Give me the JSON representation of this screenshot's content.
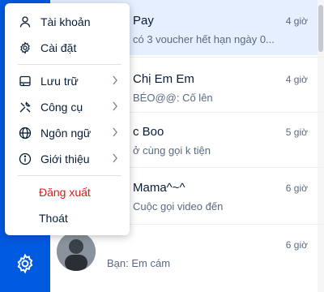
{
  "menu": {
    "items": [
      {
        "label": "Tài khoản",
        "icon": "user-icon"
      },
      {
        "label": "Cài đặt",
        "icon": "gear-icon"
      },
      {
        "label": "Lưu trữ",
        "icon": "storage-icon"
      },
      {
        "label": "Công cụ",
        "icon": "tools-icon"
      },
      {
        "label": "Ngôn ngữ",
        "icon": "globe-icon"
      },
      {
        "label": "Giới thiệu",
        "icon": "info-icon"
      },
      {
        "label": "Đăng xuất"
      },
      {
        "label": "Thoát"
      }
    ]
  },
  "conversations": [
    {
      "name": "Pay",
      "preview": "có 3 voucher hết hạn ngày 0...",
      "time": "4 giờ"
    },
    {
      "name": "Chị Em Em",
      "preview": "BÉO@@: Cố lên",
      "time": "4 giờ"
    },
    {
      "name": "c Boo",
      "preview": "ở cùng gọi k tiện",
      "time": "5 giờ"
    },
    {
      "name": "Mama^~^",
      "preview": "Cuộc gọi video đến",
      "time": "6 giờ"
    },
    {
      "name": "",
      "preview": "Bạn: Em cám",
      "time": "6 giờ"
    }
  ],
  "colors": {
    "accent": "#005ae0",
    "danger": "#d91b1b",
    "active_row": "#e5efff"
  }
}
